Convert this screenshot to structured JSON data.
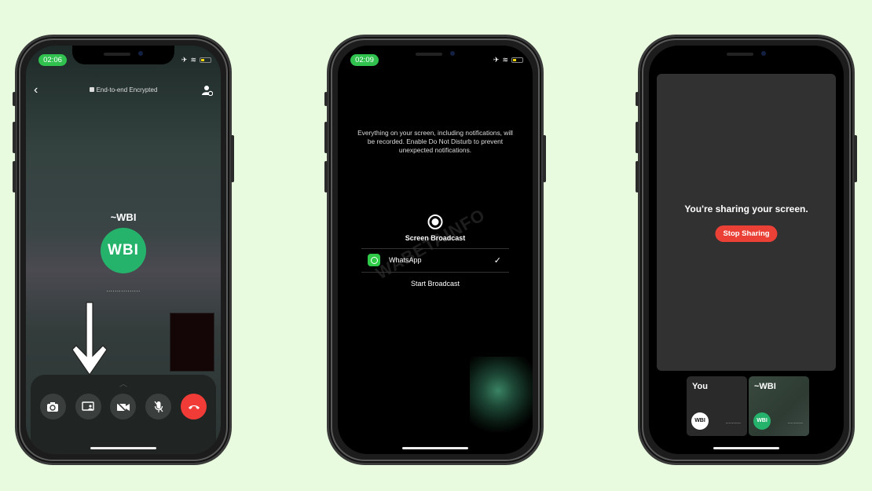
{
  "phones": {
    "call": {
      "status_time": "02:06",
      "encryption_label": "End-to-end Encrypted",
      "contact_name": "~WBI",
      "avatar_text": "WBI",
      "avatar_color": "#25b36c",
      "calling_status": "................",
      "controls": [
        "flip-camera",
        "share-screen",
        "video-off",
        "mute",
        "end-call"
      ],
      "end_call_color": "#f13b36"
    },
    "broadcast": {
      "status_time": "02:09",
      "message": "Everything on your screen, including notifications, will be recorded. Enable Do Not Disturb to prevent unexpected notifications.",
      "title": "Screen Broadcast",
      "app_label": "WhatsApp",
      "app_selected": true,
      "check_glyph": "✓",
      "start_label": "Start Broadcast",
      "watermark": "WABETAINFO"
    },
    "sharing": {
      "message": "You're sharing your screen.",
      "stop_label": "Stop Sharing",
      "stop_color": "#eb4035",
      "tiles": [
        {
          "name": "You",
          "avatar_text": "WBI",
          "status": ".........."
        },
        {
          "name": "~WBI",
          "avatar_text": "WBI",
          "status": ".........."
        }
      ]
    }
  },
  "accent_green": "#30c14f",
  "background_color": "#e8fbdf"
}
